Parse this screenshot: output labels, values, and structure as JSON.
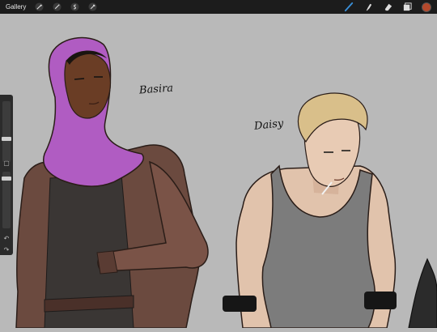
{
  "toolbar": {
    "gallery_label": "Gallery",
    "left_tools": [
      "wrench-icon",
      "magic-wand-icon",
      "selection-icon",
      "transform-icon"
    ],
    "right_tools": [
      "brush-icon",
      "smudge-icon",
      "eraser-icon",
      "layers-icon"
    ],
    "active_color": "#b5492c",
    "brush_active_color": "#3a8fd8"
  },
  "canvas": {
    "background": "#b9b9b9",
    "labels": {
      "left_character": "Basira",
      "right_character": "Daisy"
    }
  },
  "sidebar": {
    "square_button": "▢",
    "undo_button": "↶",
    "redo_button": "↷"
  }
}
